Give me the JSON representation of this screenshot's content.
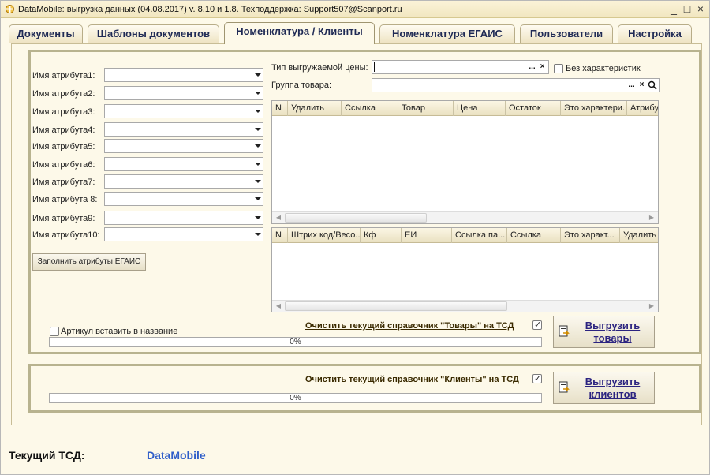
{
  "window": {
    "title": "DataMobile: выгрузка данных (04.08.2017) v. 8.10 и 1.8. Техподдержка: Support507@Scanport.ru",
    "minimize": "_",
    "maximize": "□",
    "close": "×"
  },
  "tabs": [
    {
      "label": "Документы"
    },
    {
      "label": "Шаблоны документов"
    },
    {
      "label": "Номенклатура / Клиенты"
    },
    {
      "label": "Номенклатура ЕГАИС"
    },
    {
      "label": "Пользователи"
    },
    {
      "label": "Настройка"
    }
  ],
  "active_tab": "Номенклатура / Клиенты",
  "attributes": [
    {
      "label": "Имя атрибута1:",
      "value": ""
    },
    {
      "label": "Имя атрибута2:",
      "value": ""
    },
    {
      "label": "Имя атрибута3:",
      "value": ""
    },
    {
      "label": "Имя атрибута4:",
      "value": ""
    },
    {
      "label": "Имя атрибута5:",
      "value": ""
    },
    {
      "label": "Имя атрибута6:",
      "value": ""
    },
    {
      "label": "Имя атрибута7:",
      "value": ""
    },
    {
      "label": "Имя атрибута 8:",
      "value": ""
    },
    {
      "label": "Имя атрибута9:",
      "value": ""
    },
    {
      "label": "Имя атрибута10:",
      "value": ""
    }
  ],
  "fill_egais_button": "Заполнить атрибуты ЕГАИС",
  "price_type": {
    "label": "Тип выгружаемой цены:",
    "value": "",
    "select_btn": "...",
    "clear_btn": "×"
  },
  "no_characteristics": {
    "label": "Без характеристик",
    "checked": false
  },
  "product_group": {
    "label": "Группа товара:",
    "value": "",
    "select_btn": "...",
    "clear_btn": "×",
    "search_icon": "magnifier-icon"
  },
  "goods_table": {
    "columns": [
      "N",
      "Удалить",
      "Ссылка",
      "Товар",
      "Цена",
      "Остаток",
      "Это характери...",
      "Атрибу"
    ],
    "rows": []
  },
  "barcodes_table": {
    "columns": [
      "N",
      "Штрих код/Весо...",
      "Кф",
      "ЕИ",
      "Ссылка па...",
      "Ссылка",
      "Это характ...",
      "Удалить"
    ],
    "rows": []
  },
  "article_in_name": {
    "label": "Артикул вставить в название",
    "checked": false
  },
  "goods_export": {
    "clear_label": "Очистить текущий справочник  \"Товары\" на ТСД",
    "clear_checked": true,
    "progress_text": "0%",
    "progress_value": 0,
    "button_label": "Выгрузить товары"
  },
  "clients_export": {
    "clear_label": "Очистить текущий справочник  \"Клиенты\" на ТСД",
    "clear_checked": true,
    "progress_text": "0%",
    "progress_value": 0,
    "button_label": "Выгрузить клиентов"
  },
  "footer": {
    "label": "Текущий ТСД:",
    "value": "DataMobile"
  },
  "colors": {
    "tab_text": "#1f2a55",
    "link_button": "#2b2380",
    "device_name": "#2f5ec9",
    "frame": "#b8b38f",
    "background": "#fdf9e9"
  }
}
